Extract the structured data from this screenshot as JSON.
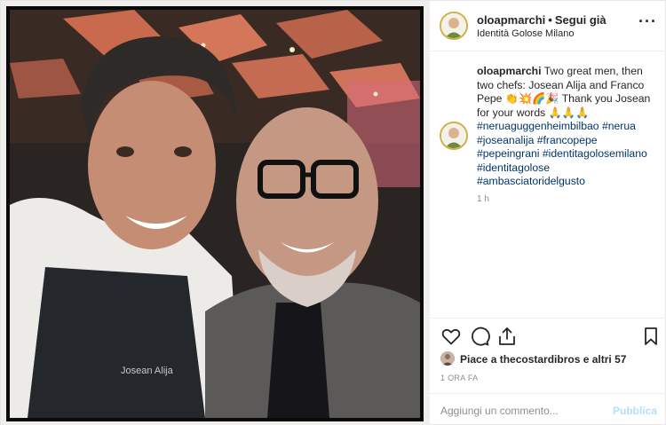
{
  "post": {
    "photo_alt": "",
    "header": {
      "username": "oloapmarchi",
      "separator": "•",
      "follow_label": "Segui già",
      "location": "Identità Golose Milano",
      "more_icon": "more-dots-icon"
    },
    "caption": {
      "username": "oloapmarchi",
      "text": "Two great men, then two chefs: Josean Alija and Franco Pepe 👏💥🌈🎉 Thank you Josean for your words 🙏🙏🙏",
      "hashtags": [
        "#neruaguggenheimbilbao",
        "#nerua",
        "#joseanalija",
        "#francopepe",
        "#pepeingrani",
        "#identitagolosemilano",
        "#identitagolose",
        "#ambasciatoridelgusto"
      ],
      "time": "1 h"
    },
    "actions": {
      "like_icon": "heart-icon",
      "comment_icon": "comment-icon",
      "share_icon": "share-icon",
      "save_icon": "bookmark-icon"
    },
    "likes": {
      "text": "Piace a thecostardibros e altri 57"
    },
    "posted_ago": "1 ORA FA",
    "comment": {
      "placeholder": "Aggiungi un commento...",
      "publish_label": "Pubblica"
    },
    "colors": {
      "link": "#003569",
      "muted": "#8e8e8e",
      "publish_disabled": "#b2dffc",
      "avatar_ring": "#d1b046"
    }
  }
}
